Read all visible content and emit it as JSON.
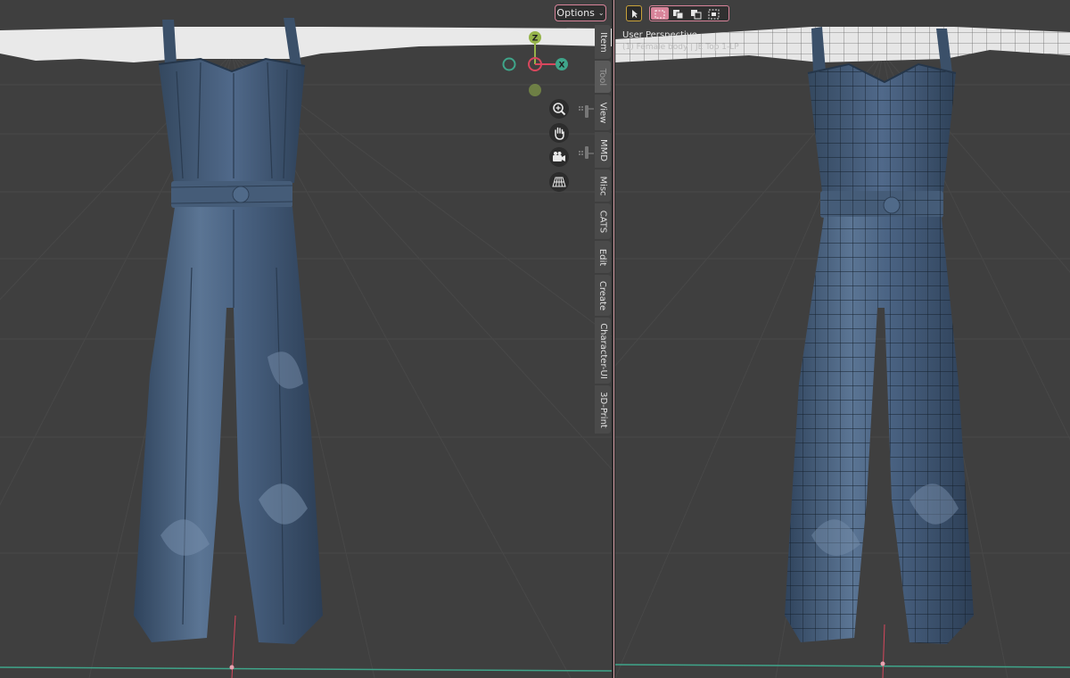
{
  "left_viewport": {
    "options_label": "Options",
    "gizmo": {
      "z_label": "Z",
      "x_label": "X"
    },
    "sidebar_tabs": [
      {
        "label": "Item",
        "active": false
      },
      {
        "label": "Tool",
        "active": true
      },
      {
        "label": "View",
        "active": false
      },
      {
        "label": "MMD",
        "active": false
      },
      {
        "label": "Misc",
        "active": false
      },
      {
        "label": "CATS",
        "active": false
      },
      {
        "label": "Edit",
        "active": false
      },
      {
        "label": "Create",
        "active": false
      },
      {
        "label": "Character-UI",
        "active": false
      },
      {
        "label": "3D-Print",
        "active": false
      }
    ],
    "nav_icons": [
      "zoom-icon",
      "pan-hand-icon",
      "camera-icon",
      "perspective-grid-icon"
    ]
  },
  "right_viewport": {
    "view_label": "User Perspective",
    "object_label": "(1) Female body | JE Top 1-LP",
    "select_icons": [
      "select-cursor-icon",
      "select-new-icon",
      "select-extend-icon",
      "select-subtract-icon",
      "select-invert-icon"
    ]
  },
  "colors": {
    "viewport_bg": "#3f3f3f",
    "grid_line": "#474747",
    "accent_pink": "#d8849a",
    "axis_x": "#d8475d",
    "axis_y_green": "#3fa58a",
    "axis_z_yellow": "#96b44a",
    "denim": "#4a6383"
  }
}
